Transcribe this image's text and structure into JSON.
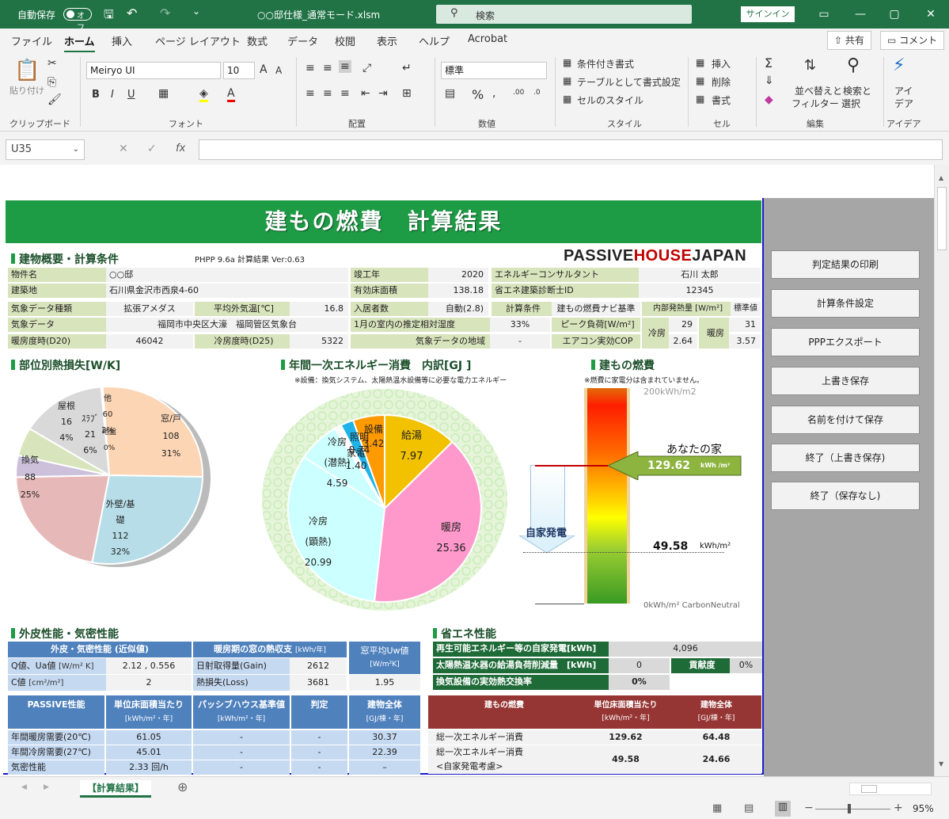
{
  "titlebar": {
    "autosave_label": "自動保存",
    "autosave_state": "オフ",
    "filename": "○○邸仕様_通常モード.xlsm",
    "search_placeholder": "検索",
    "signin": "サインイン"
  },
  "menu": {
    "items": [
      "ファイル",
      "ホーム",
      "挿入",
      "ページ レイアウト",
      "数式",
      "データ",
      "校閲",
      "表示",
      "ヘルプ",
      "Acrobat"
    ],
    "active": "ホーム",
    "share": "共有",
    "comment": "コメント"
  },
  "ribbon": {
    "clipboard": {
      "paste": "貼り付け",
      "group": "クリップボード"
    },
    "font": {
      "name": "Meiryo UI",
      "size": "10",
      "group": "フォント"
    },
    "alignment": {
      "group": "配置"
    },
    "number": {
      "format": "標準",
      "group": "数値"
    },
    "styles": {
      "conditional": "条件付き書式",
      "table": "テーブルとして書式設定",
      "cell": "セルのスタイル",
      "group": "スタイル"
    },
    "cells": {
      "insert": "挿入",
      "delete": "削除",
      "format": "書式",
      "group": "セル"
    },
    "editing": {
      "sort1": "並べ替えと",
      "sort2": "フィルター",
      "find1": "検索と",
      "find2": "選択",
      "group": "編集"
    },
    "ideas": {
      "label1": "アイ",
      "label2": "デア",
      "group": "アイデア"
    }
  },
  "formula_bar": {
    "cell_ref": "U35",
    "fx": "fx"
  },
  "sheet": {
    "banner": "建もの燃費　計算結果",
    "section_overview": "建物概要・計算条件",
    "version": "PHPP 9.6a  計算結果 Ver:0.63",
    "logo": "PASSIVEHOUSEJAPAN",
    "overview": {
      "bukken_label": "物件名",
      "bukken": "○○邸",
      "site_label": "建築地",
      "site": "石川県金沢市西泉4-60",
      "wx_type_label": "気象データ種類",
      "wx_type": "拡張アメダス",
      "avg_temp_label": "平均外気温[℃]",
      "avg_temp": "16.8",
      "wx_label": "気象データ",
      "wx": "福岡市中央区大濠　福岡管区気象台",
      "hdd_label": "暖房度時(D20)",
      "hdd": "46042",
      "cdd_label": "冷房度時(D25)",
      "cdd": "5322",
      "year_label": "竣工年",
      "year": "2020",
      "area_label": "有効床面積",
      "area": "138.18",
      "occ_label": "入居者数",
      "occ": "自動(2.8)",
      "rh_label": "1月の室内の推定相対湿度",
      "rh": "33%",
      "region_label": "気象データの地域",
      "region": "-",
      "consultant_label": "エネルギーコンサルタント",
      "consultant": "石川 太郎",
      "diag_label": "省エネ建築診断士ID",
      "diag": "12345",
      "calc_label": "計算条件",
      "calc": "建もの燃費ナビ基準",
      "internal_label": "内部発熱量 [W/m²]",
      "internal": "標準値",
      "peak_label": "ピーク負荷[W/m²]",
      "cool_label": "冷房",
      "heat_label": "暖房",
      "peak_cool": "29",
      "peak_heat": "31",
      "cop_label": "エアコン実効COP",
      "cop_cool": "2.64",
      "cop_heat": "3.57"
    },
    "section_heatloss": "部位別熱損失[W/K]",
    "section_energy": "年間一次エネルギー消費　内訳[GJ ]",
    "energy_note": "※設備：換気システム、太陽熱温水設備等に必要な電力エネルギー",
    "section_nenpi": "建もの燃費",
    "nenpi_note": "※燃費に家電分は含まれていません。",
    "gauge": {
      "top": "200kWh/m2",
      "bottom": "0kWh/m² CarbonNeutral",
      "your_house": "あなたの家",
      "value": "129.62",
      "unit": "kWh /m²",
      "self_gen": "自家発電",
      "net_value": "49.58",
      "net_unit": "kWh/m²"
    },
    "section_envelope": "外皮性能・気密性能",
    "envelope": {
      "h1": "外皮・気密性能 (近似値)",
      "q_label": "Q値、Ua値",
      "q_unit": "[W/m² K]",
      "q_val": "2.12 , 0.556",
      "c_label": "C値",
      "c_unit": "[cm²/m²]",
      "c_val": "2",
      "h2": "暖房期の窓の熱収支",
      "h2_unit": "[kWh/年]",
      "gain_label": "日射取得量(Gain)",
      "gain": "2612",
      "loss_label": "熱損失(Loss)",
      "loss": "3681",
      "uw_label": "窓平均Uw値",
      "uw_unit": "[W/m²K]",
      "uw": "1.95"
    },
    "passive_table": {
      "headers": [
        "PASSIVE性能",
        "単位床面積当たり",
        "パッシブハウス基準値",
        "判定",
        "建物全体"
      ],
      "subheaders": [
        "",
        "[kWh/m²・年]",
        "[kWh/m²・年]",
        "",
        "[GJ/棟・年]"
      ],
      "rows": [
        [
          "年間暖房需要(20℃)",
          "61.05",
          "-",
          "-",
          "30.37"
        ],
        [
          "年間冷房需要(27℃)",
          "45.01",
          "-",
          "-",
          "22.39"
        ],
        [
          "気密性能",
          "2.33 回/h",
          "-",
          "-",
          "–"
        ]
      ]
    },
    "section_energysave": "省エネ性能",
    "energysave": {
      "renew_label": "再生可能エネルギー等の自家発電[kWh]",
      "renew": "4,096",
      "solar_label": "太陽熱温水器の給湯負荷削減量　[kWh]",
      "solar": "0",
      "contrib_label": "貢献度",
      "contrib": "0%",
      "vent_label": "換気設備の実効熱交換率",
      "vent": "0%"
    },
    "nenpi_table": {
      "headers": [
        "建もの燃費",
        "単位床面積当たり",
        "建物全体"
      ],
      "subheaders": [
        "",
        "[kWh/m²・年]",
        "[GJ/棟・年]"
      ],
      "rows": [
        [
          "総一次エネルギー消費",
          "129.62",
          "64.48"
        ],
        [
          "総一次エネルギー消費\n<自家発電考慮>",
          "49.58",
          "24.66"
        ]
      ]
    }
  },
  "chart_data": [
    {
      "type": "pie",
      "title": "部位別熱損失[W/K]",
      "series": [
        {
          "values": [
            108,
            112,
            88,
            16,
            21,
            60,
            0
          ]
        }
      ],
      "categories": [
        "窓/戸",
        "外壁/基礎",
        "換気",
        "屋根",
        "ｽﾗﾌﾞ",
        "他",
        "地盤"
      ],
      "labels": [
        "窓/戸\n108\n31%",
        "外壁/基\n礎\n112\n32%",
        "換気\n88\n25%",
        "屋根\n16\n4%",
        "ｽﾗﾌﾞ\n21\n6%",
        "他\n60\n2%",
        "地盤\n0%"
      ],
      "colors": [
        "#fcd5b4",
        "#b7dee8",
        "#e6b8b7",
        "#ccc0da",
        "#d8e4bc",
        "#d9d9d9",
        "#8064a2"
      ]
    },
    {
      "type": "pie",
      "title": "年間一次エネルギー消費　内訳[GJ ]",
      "categories": [
        "給湯",
        "暖房",
        "冷房(顕熱)",
        "冷房(潜熱)",
        "照明",
        "家電",
        "設備"
      ],
      "series": [
        {
          "values": [
            7.97,
            25.36,
            20.99,
            4.59,
            0.74,
            1.4,
            3.42
          ]
        }
      ],
      "labels": [
        "給湯\n7.97",
        "暖房\n25.36",
        "冷房\n(顕熱)\n20.99",
        "冷房\n(潜熱)\n4.59",
        "照明\n0.74",
        "家電\n1.40",
        "設備\n3.42"
      ],
      "colors": [
        "#f2c200",
        "#ff99cc",
        "#ccffff",
        "#ccffff",
        "#ffffff",
        "#1fb3e8",
        "#ff9900"
      ]
    }
  ],
  "macros": [
    "判定結果の印刷",
    "計算条件設定",
    "PPPエクスポート",
    "上書き保存",
    "名前を付けて保存",
    "終了（上書き保存)",
    "終了（保存なし)"
  ],
  "tabs": {
    "sheet": "【計算結果】"
  },
  "status": {
    "zoom": "95%"
  }
}
